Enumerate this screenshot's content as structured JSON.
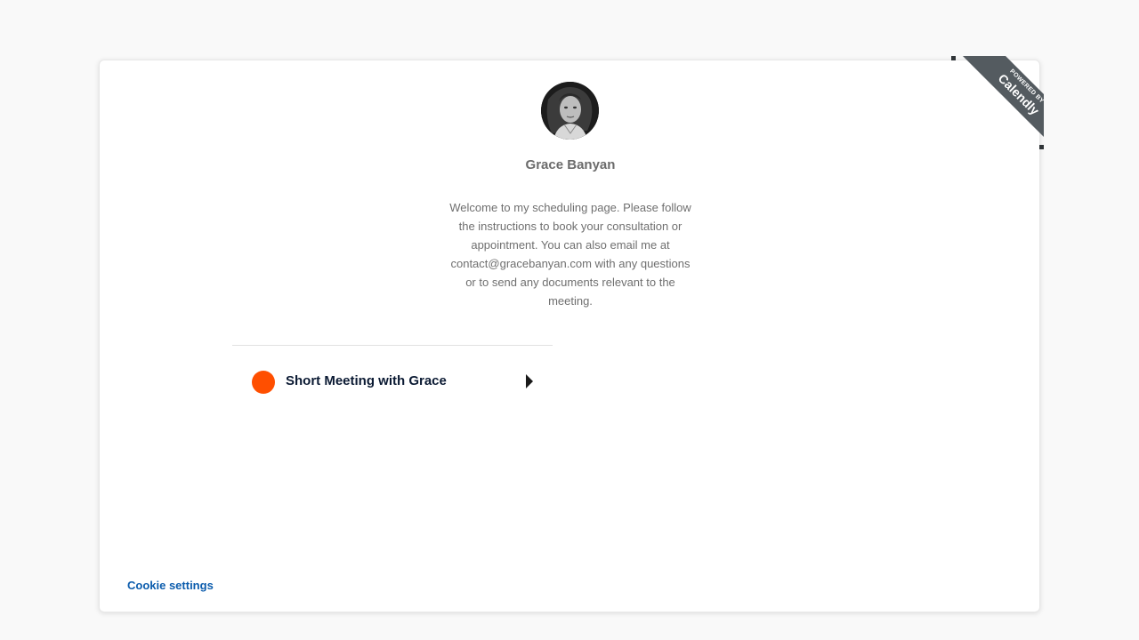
{
  "ribbon": {
    "powered_by": "POWERED BY",
    "brand": "Calendly"
  },
  "profile": {
    "name": "Grace Banyan",
    "welcome": "Welcome to my scheduling page. Please follow the instructions to book your consultation or appointment. You can also email me at contact@gracebanyan.com with any questions or to send any documents relevant to the meeting."
  },
  "events": [
    {
      "label": "Short Meeting with Grace",
      "color": "#ff4f00"
    }
  ],
  "footer": {
    "cookie_settings": "Cookie settings"
  }
}
